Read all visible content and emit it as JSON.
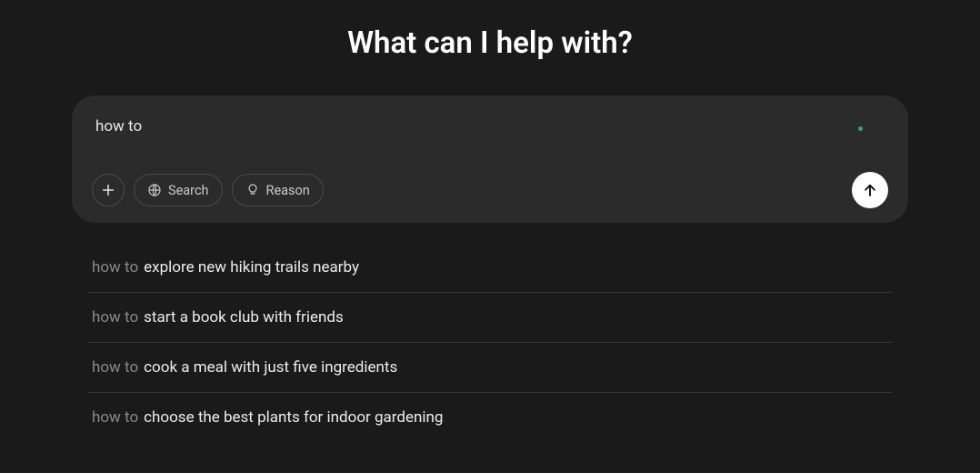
{
  "heading": "What can I help with?",
  "input": {
    "value": "how to",
    "placeholder": ""
  },
  "buttons": {
    "search_label": "Search",
    "reason_label": "Reason"
  },
  "suggestions": [
    {
      "prefix": "how to",
      "text": "explore new hiking trails nearby"
    },
    {
      "prefix": "how to",
      "text": "start a book club with friends"
    },
    {
      "prefix": "how to",
      "text": "cook a meal with just five ingredients"
    },
    {
      "prefix": "how to",
      "text": "choose the best plants for indoor gardening"
    }
  ]
}
